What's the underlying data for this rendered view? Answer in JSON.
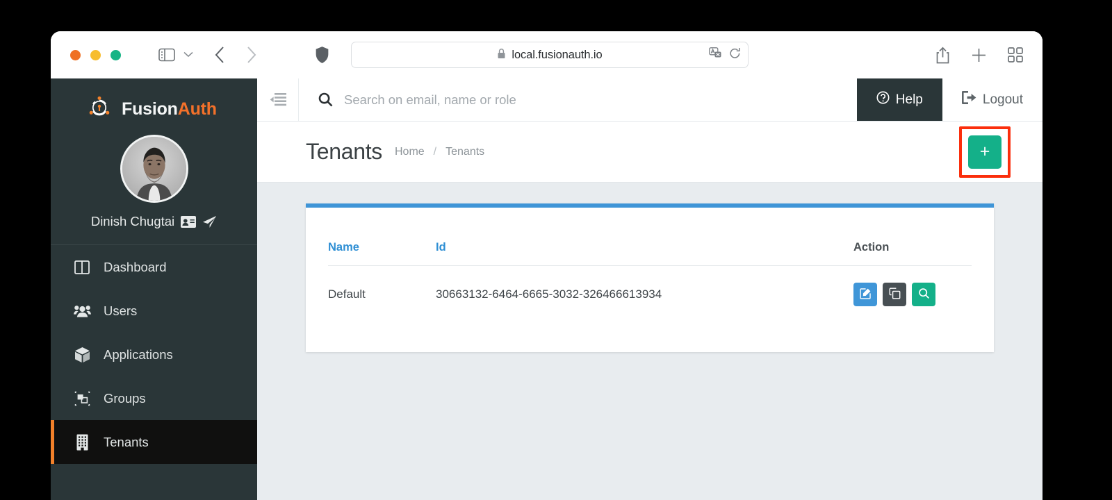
{
  "browser": {
    "url": "local.fusionauth.io",
    "lock_icon": "padlock-icon",
    "traffic_lights": [
      "close-button",
      "minimize-button",
      "maximize-button"
    ],
    "toolbar_icons": [
      "sidebar-toggle-icon",
      "chevron-down-icon",
      "back-icon",
      "forward-icon",
      "shield-icon",
      "translate-icon",
      "reload-icon",
      "share-icon",
      "new-tab-icon",
      "tab-overview-icon"
    ]
  },
  "sidebar": {
    "brand": {
      "first": "Fusion",
      "second": "Auth"
    },
    "profile": {
      "name": "Dinish Chugtai",
      "icons": [
        "id-card-icon",
        "paper-plane-icon"
      ]
    },
    "items": [
      {
        "label": "Dashboard",
        "icon": "dashboard-icon",
        "active": false
      },
      {
        "label": "Users",
        "icon": "users-icon",
        "active": false
      },
      {
        "label": "Applications",
        "icon": "cube-icon",
        "active": false
      },
      {
        "label": "Groups",
        "icon": "groups-icon",
        "active": false
      },
      {
        "label": "Tenants",
        "icon": "building-icon",
        "active": true
      }
    ]
  },
  "topbar": {
    "collapse_icon": "collapse-sidebar-icon",
    "search": {
      "placeholder": "Search on email, name or role",
      "value": "",
      "icon": "search-icon"
    },
    "help_label": "Help",
    "logout_label": "Logout"
  },
  "page": {
    "title": "Tenants",
    "breadcrumb": {
      "home": "Home",
      "separator": "/",
      "current": "Tenants"
    },
    "add_button_label": "+",
    "add_button_highlighted": true
  },
  "table": {
    "columns": [
      "Name",
      "Id",
      "Action"
    ],
    "rows": [
      {
        "name": "Default",
        "id": "30663132-6464-6665-3032-326466613934",
        "actions": [
          "edit-icon",
          "duplicate-icon",
          "view-icon"
        ]
      }
    ]
  },
  "colors": {
    "sidebar_bg": "#2a3638",
    "sidebar_active_bg": "#10100f",
    "accent_orange": "#f3812a",
    "brand_orange": "#f3712a",
    "content_bg": "#e8ecef",
    "card_top_border": "#3f95d7",
    "link_blue": "#2f8fd4",
    "green": "#14b089",
    "blue_button": "#3f96d8",
    "dark_button": "#474f53",
    "highlight_red": "#fb2e0c"
  }
}
